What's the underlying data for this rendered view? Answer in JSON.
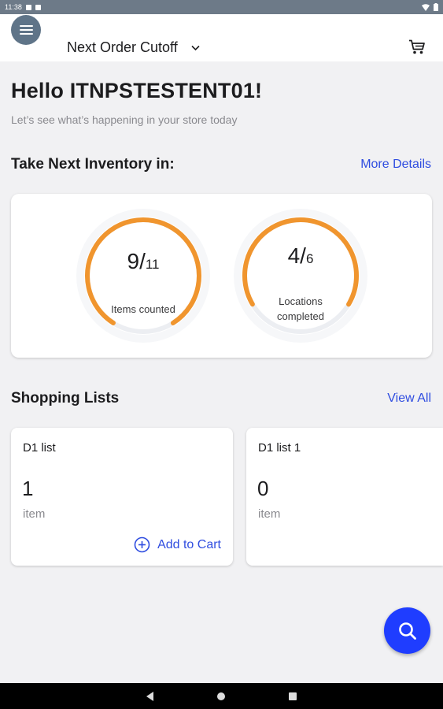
{
  "status_bar": {
    "time": "11:38"
  },
  "app_bar": {
    "dropdown_label": "Next Order Cutoff"
  },
  "greeting": {
    "title": "Hello ITNPSTESTENT01!",
    "subtitle": "Let’s see what’s happening in your store today"
  },
  "inventory": {
    "title": "Take Next Inventory in:",
    "link": "More Details",
    "items_counted": {
      "done": "9",
      "slash": "/",
      "total": "11",
      "label": "Items counted",
      "progress": 0.82
    },
    "locations": {
      "done": "4",
      "slash": "/",
      "total": "6",
      "label_line1": "Locations",
      "label_line2": "completed",
      "progress": 0.67
    },
    "ring_color": "#f0952e",
    "ring_track_color": "#eceef2"
  },
  "shopping_lists": {
    "title": "Shopping Lists",
    "link": "View All",
    "lists": [
      {
        "name": "D1 list",
        "count": "1",
        "unit": "item",
        "action": "Add to Cart"
      },
      {
        "name": "D1 list 1",
        "count": "0",
        "unit": "item"
      }
    ]
  },
  "colors": {
    "accent": "#2f4de0",
    "fab": "#1f3dff",
    "menu_button": "#5f7488"
  }
}
